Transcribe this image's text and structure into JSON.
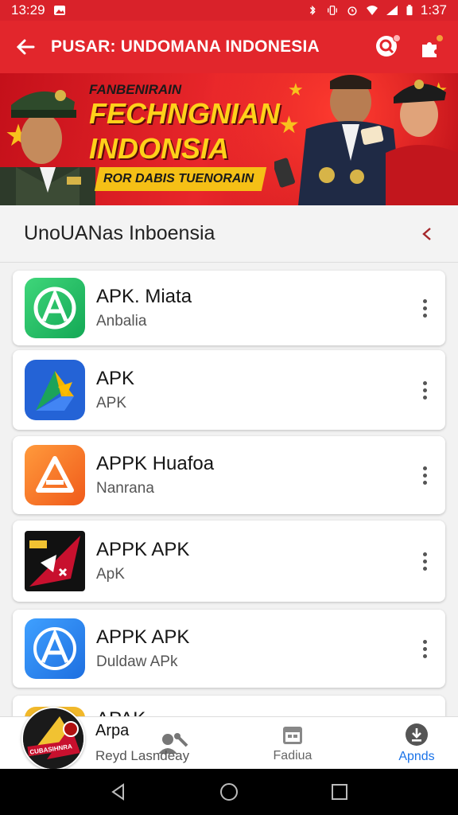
{
  "status_bar": {
    "time_left": "13:29",
    "time_right": "1:37"
  },
  "app_bar": {
    "title": "PUSAR: UNDOMANA INDONESIA"
  },
  "banner": {
    "small_text": "FANBENIRAIN",
    "line1": "FECHNGNIAN",
    "line2": "INDONSIA",
    "subline": "ROR DABIS TUENORAIN",
    "accent_color": "#ffd11a",
    "bg_color": "#d7141c"
  },
  "section": {
    "title": "UnoUANas Inboensia"
  },
  "apps": [
    {
      "title": "APK. Miata",
      "subtitle": "Anbalia",
      "icon": "green-a-icon"
    },
    {
      "title": "APK",
      "subtitle": "APK",
      "icon": "blue-triangle-icon"
    },
    {
      "title": "APPK Huafoa",
      "subtitle": "Nanrana",
      "icon": "orange-a-icon"
    },
    {
      "title": "APPK APK",
      "subtitle": "ApK",
      "icon": "black-star-icon"
    },
    {
      "title": "APPK APK",
      "subtitle": "Duldaw APk",
      "icon": "blue-a-icon"
    },
    {
      "title": "APAK",
      "subtitle": "",
      "icon": "yellow-icon"
    }
  ],
  "bottom_nav": {
    "featured_title": "Arpa",
    "featured_sub": "Reyd Lasndeay",
    "items": [
      {
        "label": "Fadiua",
        "icon": "calendar-icon"
      },
      {
        "label": "Apnds",
        "icon": "download-icon",
        "active": true
      }
    ],
    "active_color": "#1a73e8"
  },
  "avatar_badge": "CUBASIHNRA"
}
